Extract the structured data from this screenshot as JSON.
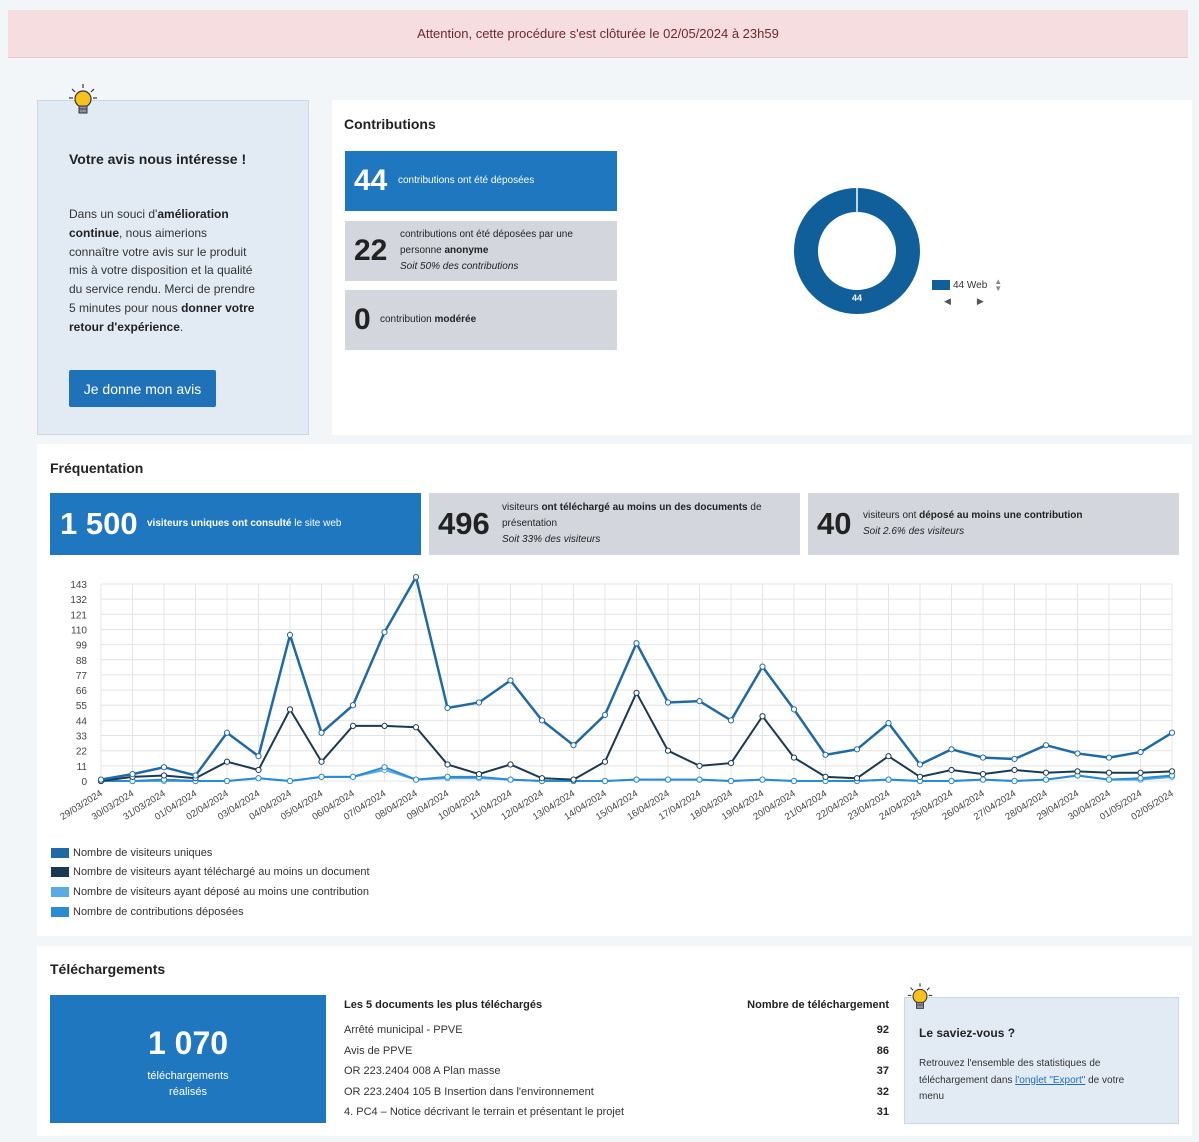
{
  "banner": {
    "text": "Attention, cette procédure s'est clôturée le 02/05/2024 à 23h59"
  },
  "feedback": {
    "title": "Votre avis nous intéresse !",
    "text_html": "Dans un souci d'<b>amélioration continue</b>, nous aimerions connaître votre avis sur le produit mis à votre disposition et la qualité du service rendu. Merci de prendre 5 minutes pour nous <b>donner votre retour d'expérience</b>.",
    "button": "Je donne mon avis"
  },
  "contributions": {
    "title": "Contributions",
    "total": {
      "value": "44",
      "text": "contributions ont été déposées"
    },
    "anonymous": {
      "value": "22",
      "text_a": "contributions ont été déposées par une personne ",
      "text_bold": "anonyme",
      "note": "Soit 50% des contributions"
    },
    "moderated": {
      "value": "0",
      "text_a": "contribution ",
      "text_bold": "modérée"
    },
    "donut": {
      "center_label": "44",
      "legend_label": "44 Web",
      "color": "#115f9a"
    }
  },
  "frequentation": {
    "title": "Fréquentation",
    "visitors": {
      "value": "1 500",
      "text_bold": "visiteurs uniques ont consulté",
      "text_b": " le site web"
    },
    "downloaders": {
      "value": "496",
      "text_a": "visiteurs ",
      "text_bold": "ont téléchargé au moins un des documents",
      "text_b": " de présentation",
      "note": "Soit 33% des visiteurs"
    },
    "contributors": {
      "value": "40",
      "text_a": "visiteurs ont ",
      "text_bold": "déposé au moins une contribution",
      "note": "Soit 2.6% des visiteurs"
    }
  },
  "chart_data": {
    "type": "line",
    "categories": [
      "29/03/2024",
      "30/03/2024",
      "31/03/2024",
      "01/04/2024",
      "02/04/2024",
      "03/04/2024",
      "04/04/2024",
      "05/04/2024",
      "06/04/2024",
      "07/04/2024",
      "08/04/2024",
      "09/04/2024",
      "10/04/2024",
      "11/04/2024",
      "12/04/2024",
      "13/04/2024",
      "14/04/2024",
      "15/04/2024",
      "16/04/2024",
      "17/04/2024",
      "18/04/2024",
      "19/04/2024",
      "20/04/2024",
      "21/04/2024",
      "22/04/2024",
      "23/04/2024",
      "24/04/2024",
      "25/04/2024",
      "26/04/2024",
      "27/04/2024",
      "28/04/2024",
      "29/04/2024",
      "30/04/2024",
      "01/05/2024",
      "02/05/2024"
    ],
    "y_ticks": [
      0,
      11,
      22,
      33,
      44,
      55,
      66,
      77,
      88,
      99,
      110,
      121,
      132,
      143
    ],
    "ylim": [
      0,
      143
    ],
    "grid": true,
    "legend_position": "bottom-left",
    "series": [
      {
        "name": "Nombre de visiteurs uniques",
        "color": "#1f6aa5",
        "values": [
          1,
          5,
          10,
          4,
          35,
          18,
          106,
          35,
          55,
          108,
          148,
          53,
          57,
          73,
          44,
          26,
          48,
          100,
          57,
          58,
          44,
          83,
          52,
          19,
          23,
          42,
          12,
          23,
          17,
          16,
          26,
          20,
          17,
          21,
          35
        ]
      },
      {
        "name": "Nombre de visiteurs ayant téléchargé au moins un document",
        "color": "#1a3a52",
        "values": [
          0,
          3,
          4,
          2,
          14,
          8,
          52,
          14,
          40,
          40,
          39,
          12,
          5,
          12,
          2,
          1,
          14,
          64,
          22,
          11,
          13,
          47,
          17,
          3,
          2,
          18,
          3,
          8,
          5,
          8,
          6,
          7,
          6,
          6,
          7
        ]
      },
      {
        "name": "Nombre de visiteurs ayant déposé au moins une contribution",
        "color": "#5aaae6",
        "values": [
          0,
          0,
          0,
          0,
          0,
          2,
          0,
          3,
          3,
          8,
          1,
          2,
          2,
          1,
          0,
          0,
          0,
          1,
          1,
          1,
          0,
          1,
          0,
          0,
          0,
          1,
          0,
          0,
          1,
          0,
          1,
          4,
          1,
          1,
          3
        ]
      },
      {
        "name": "Nombre de contributions déposées",
        "color": "#2b8ad4",
        "values": [
          0,
          0,
          1,
          0,
          0,
          2,
          0,
          3,
          3,
          10,
          1,
          3,
          3,
          1,
          0,
          0,
          0,
          1,
          1,
          1,
          0,
          1,
          0,
          0,
          0,
          1,
          0,
          0,
          1,
          0,
          1,
          4,
          1,
          2,
          4
        ]
      }
    ]
  },
  "downloads": {
    "title": "Téléchargements",
    "total": {
      "value": "1 070",
      "text": "téléchargements réalisés"
    },
    "table_head_doc": "Les 5 documents les plus téléchargés",
    "table_head_count": "Nombre de téléchargement",
    "rows": [
      {
        "doc": "Arrêté municipal - PPVE",
        "count": "92"
      },
      {
        "doc": "Avis de PPVE",
        "count": "86"
      },
      {
        "doc": "OR 223.2404 008 A Plan masse",
        "count": "37"
      },
      {
        "doc": "OR 223.2404 105 B Insertion dans l'environnement",
        "count": "32"
      },
      {
        "doc": "4. PC4 – Notice décrivant le terrain et présentant le projet",
        "count": "31"
      }
    ],
    "tip": {
      "title": "Le saviez-vous ?",
      "text_a": "Retrouvez l'ensemble des statistiques de téléchargement dans ",
      "link": "l'onglet \"Export\"",
      "text_b": " de votre menu"
    }
  }
}
